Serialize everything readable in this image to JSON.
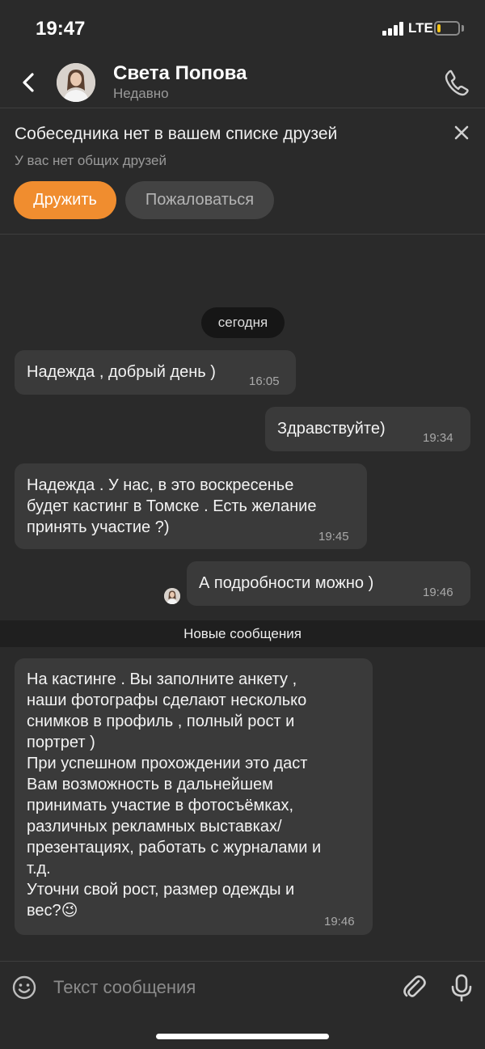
{
  "status_bar": {
    "time": "19:47",
    "network": "LTE",
    "battery_level": 0.15,
    "battery_color": "#f5c518"
  },
  "header": {
    "back_icon": "chevron-left-icon",
    "contact_name": "Света Попова",
    "contact_status": "Недавно",
    "call_icon": "phone-icon"
  },
  "stranger_panel": {
    "title": "Собеседника нет в вашем списке друзей",
    "subtitle": "У вас нет общих друзей",
    "add_friend_label": "Дружить",
    "report_label": "Пожаловаться",
    "accent_color": "#f08d2f"
  },
  "chat": {
    "date_label": "сегодня",
    "new_messages_label": "Новые сообщения",
    "messages": [
      {
        "direction": "incoming",
        "text": "Надежда , добрый день )",
        "time": "16:05"
      },
      {
        "direction": "outgoing",
        "text": "Здравствуйте)",
        "time": "19:34"
      },
      {
        "direction": "incoming",
        "text": "Надежда . У нас, в это воскресенье\nбудет кастинг в Томске . Есть желание\nпринять участие ?)",
        "time": "19:45"
      },
      {
        "direction": "outgoing",
        "text": "А подробности можно )",
        "time": "19:46"
      },
      {
        "direction": "incoming",
        "text": "На  кастинге  . Вы заполните анкету ,\nнаши фотографы сделают несколько\nснимков в профиль , полный рост и\nпортрет )\nПри успешном прохождении это даст\nВам возможность в дальнейшем\nпринимать участие в фотосъёмках,\nразличных рекламных выставках/\nпрезентациях, работать с журналами и\nт.д.\nУточни свой рост, размер одежды и\nвес?😉",
        "time": "19:46"
      }
    ]
  },
  "composer": {
    "placeholder": "Текст сообщения",
    "emoji_icon": "smiley-icon",
    "attach_icon": "paperclip-icon",
    "mic_icon": "microphone-icon"
  }
}
